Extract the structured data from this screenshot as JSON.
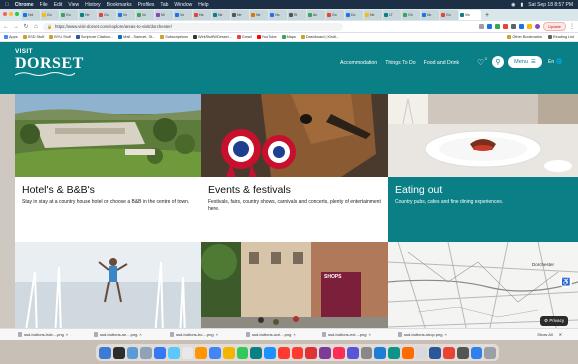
{
  "menubar": {
    "app": "Chrome",
    "items": [
      "File",
      "Edit",
      "View",
      "History",
      "Bookmarks",
      "Profiles",
      "Tab",
      "Window",
      "Help"
    ],
    "clock": "Sat Sep 18 8:57 PM"
  },
  "tabs": [
    {
      "label": "Hol",
      "color": "#1a73e8"
    },
    {
      "label": "Go",
      "color": "#fbbc04"
    },
    {
      "label": "Go",
      "color": "#34a853"
    },
    {
      "label": "He",
      "color": "#0b7f86"
    },
    {
      "label": "Go",
      "color": "#ea4335"
    },
    {
      "label": "Vo",
      "color": "#1a73e8"
    },
    {
      "label": "Vo",
      "color": "#34a853"
    },
    {
      "label": "Mi",
      "color": "#8e44ad"
    },
    {
      "label": "Vo",
      "color": "#1a73e8"
    },
    {
      "label": "Ha",
      "color": "#ea4335"
    },
    {
      "label": "Ne",
      "color": "#0b7f86"
    },
    {
      "label": "Ne",
      "color": "#555555"
    },
    {
      "label": "Ne",
      "color": "#e37400"
    },
    {
      "label": "Ha",
      "color": "#1a73e8"
    },
    {
      "label": "Ri",
      "color": "#555555"
    },
    {
      "label": "An",
      "color": "#34a853"
    },
    {
      "label": "Go",
      "color": "#ea4335"
    },
    {
      "label": "Do",
      "color": "#1a73e8"
    },
    {
      "label": "Ne",
      "color": "#fbbc04"
    },
    {
      "label": "LT",
      "color": "#0b7f86"
    },
    {
      "label": "Gh",
      "color": "#34a853"
    },
    {
      "label": "Nc",
      "color": "#1a73e8"
    },
    {
      "label": "Go",
      "color": "#ea4335"
    },
    {
      "label": "Vis",
      "color": "#0b7f86",
      "active": true
    }
  ],
  "toolbar": {
    "url": "https://www.visit-dorset.com/explore/areas-to-visit/dorchester/",
    "update_label": "Update"
  },
  "bookmarks": {
    "items": [
      "Apps",
      "SSD Stuff",
      "BYU Stuff",
      "Scripture Citation...",
      "Mail - Samuel, St...",
      "Subscriptions",
      "WirkStuffWDessel...",
      "Gmail",
      "YouTube",
      "Maps",
      "Dashboard | Kindl..."
    ],
    "right": [
      "Other Bookmarks",
      "Reading List"
    ]
  },
  "site": {
    "logo_top": "VISIT",
    "logo_main": "DORSET",
    "nav": [
      "Accommodation",
      "Things To Do",
      "Food and Drink"
    ],
    "heart_count": "0",
    "menu_label": "Menu",
    "lang_label": "En"
  },
  "cards": [
    {
      "title": "Hotel's & B&B's",
      "text": "Stay in stay at a country house hotel or choose a B&B in the centre of town."
    },
    {
      "title": "Events & festivals",
      "text": "Festivals, fairs, country shows, carnivals and concerts, plenty of entertainment here."
    },
    {
      "title": "Eating out",
      "text": "Country pubs, cafes and fine dining experiences."
    }
  ],
  "bottom": {
    "shop_sign": "SHOPS",
    "map_label": "Dorchester",
    "privacy_label": "Privacy"
  },
  "downloads": {
    "files": [
      "ssd-buttons-hab....png",
      "ssd-buttons-se....png",
      "ssd-buttons-bo....png",
      "ssd-buttons-scri....png",
      "ssd-buttons-ext....png",
      "ssd-buttons-shop.png"
    ],
    "show_all": "Show All"
  },
  "dock": {
    "apps": [
      "#3a7bd5",
      "#2d2d2d",
      "#5b9bd5",
      "#8fa3b8",
      "#3478f6",
      "#5ac8fa",
      "#e8e8e8",
      "#ff9500",
      "#4285f4",
      "#f4b400",
      "#34c759",
      "#0b7f86",
      "#1e90ff",
      "#ff3b30",
      "#ff3b30",
      "#d33",
      "#7d3c98",
      "#ff2d55",
      "#5856d6",
      "#888888",
      "#1c7ed6",
      "#0d9488",
      "#ff6b00",
      "#d9d9d9",
      "#2b579a",
      "#ea4335",
      "#555555",
      "#2f80ed",
      "#9aa0a6"
    ]
  }
}
